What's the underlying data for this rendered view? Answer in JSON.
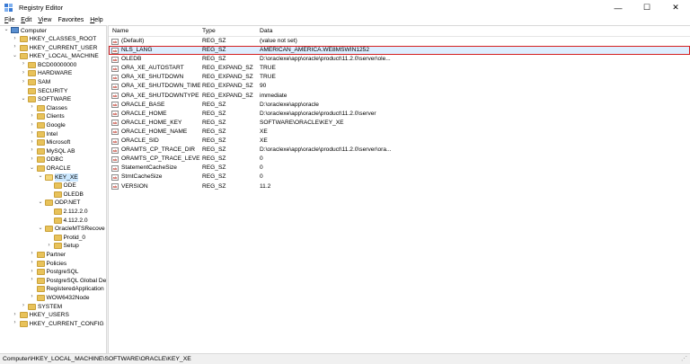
{
  "window": {
    "title": "Registry Editor",
    "minimize_glyph": "—",
    "maximize_glyph": "☐",
    "close_glyph": "✕"
  },
  "menu": [
    {
      "key": "F",
      "rest": "ile"
    },
    {
      "key": "E",
      "rest": "dit"
    },
    {
      "key": "V",
      "rest": "iew"
    },
    {
      "key": "",
      "rest": "Favorites"
    },
    {
      "key": "H",
      "rest": "elp"
    }
  ],
  "tree": [
    {
      "label": "Computer",
      "depth": 0,
      "expander": "⌄",
      "icon": "computer",
      "selected": false
    },
    {
      "label": "HKEY_CLASSES_ROOT",
      "depth": 1,
      "expander": "›",
      "icon": "folder",
      "selected": false
    },
    {
      "label": "HKEY_CURRENT_USER",
      "depth": 1,
      "expander": "›",
      "icon": "folder",
      "selected": false
    },
    {
      "label": "HKEY_LOCAL_MACHINE",
      "depth": 1,
      "expander": "⌄",
      "icon": "folder",
      "selected": false
    },
    {
      "label": "BCD00000000",
      "depth": 2,
      "expander": "›",
      "icon": "folder",
      "selected": false
    },
    {
      "label": "HARDWARE",
      "depth": 2,
      "expander": "›",
      "icon": "folder",
      "selected": false
    },
    {
      "label": "SAM",
      "depth": 2,
      "expander": "›",
      "icon": "folder",
      "selected": false
    },
    {
      "label": "SECURITY",
      "depth": 2,
      "expander": "",
      "icon": "folder",
      "selected": false
    },
    {
      "label": "SOFTWARE",
      "depth": 2,
      "expander": "⌄",
      "icon": "folder",
      "selected": false
    },
    {
      "label": "Classes",
      "depth": 3,
      "expander": "›",
      "icon": "folder",
      "selected": false
    },
    {
      "label": "Clients",
      "depth": 3,
      "expander": "›",
      "icon": "folder",
      "selected": false
    },
    {
      "label": "Google",
      "depth": 3,
      "expander": "›",
      "icon": "folder",
      "selected": false
    },
    {
      "label": "Intel",
      "depth": 3,
      "expander": "›",
      "icon": "folder",
      "selected": false
    },
    {
      "label": "Microsoft",
      "depth": 3,
      "expander": "›",
      "icon": "folder",
      "selected": false
    },
    {
      "label": "MySQL AB",
      "depth": 3,
      "expander": "›",
      "icon": "folder",
      "selected": false
    },
    {
      "label": "ODBC",
      "depth": 3,
      "expander": "›",
      "icon": "folder",
      "selected": false
    },
    {
      "label": "ORACLE",
      "depth": 3,
      "expander": "⌄",
      "icon": "folder",
      "selected": false
    },
    {
      "label": "KEY_XE",
      "depth": 4,
      "expander": "⌄",
      "icon": "folder-open",
      "selected": true
    },
    {
      "label": "ODE",
      "depth": 5,
      "expander": "",
      "icon": "folder",
      "selected": false
    },
    {
      "label": "OLEDB",
      "depth": 5,
      "expander": "",
      "icon": "folder",
      "selected": false
    },
    {
      "label": "ODP.NET",
      "depth": 4,
      "expander": "⌄",
      "icon": "folder",
      "selected": false
    },
    {
      "label": "2.112.2.0",
      "depth": 5,
      "expander": "",
      "icon": "folder",
      "selected": false
    },
    {
      "label": "4.112.2.0",
      "depth": 5,
      "expander": "",
      "icon": "folder",
      "selected": false
    },
    {
      "label": "OracleMTSRecove",
      "depth": 4,
      "expander": "⌄",
      "icon": "folder",
      "selected": false
    },
    {
      "label": "Protid_0",
      "depth": 5,
      "expander": "",
      "icon": "folder",
      "selected": false
    },
    {
      "label": "Setup",
      "depth": 5,
      "expander": "›",
      "icon": "folder",
      "selected": false
    },
    {
      "label": "Partner",
      "depth": 3,
      "expander": "›",
      "icon": "folder",
      "selected": false
    },
    {
      "label": "Policies",
      "depth": 3,
      "expander": "›",
      "icon": "folder",
      "selected": false
    },
    {
      "label": "PostgreSQL",
      "depth": 3,
      "expander": "›",
      "icon": "folder",
      "selected": false
    },
    {
      "label": "PostgreSQL Global De",
      "depth": 3,
      "expander": "›",
      "icon": "folder",
      "selected": false
    },
    {
      "label": "RegisteredApplication",
      "depth": 3,
      "expander": "",
      "icon": "folder",
      "selected": false
    },
    {
      "label": "WOW6432Node",
      "depth": 3,
      "expander": "›",
      "icon": "folder",
      "selected": false
    },
    {
      "label": "SYSTEM",
      "depth": 2,
      "expander": "›",
      "icon": "folder",
      "selected": false
    },
    {
      "label": "HKEY_USERS",
      "depth": 1,
      "expander": "›",
      "icon": "folder",
      "selected": false
    },
    {
      "label": "HKEY_CURRENT_CONFIG",
      "depth": 1,
      "expander": "›",
      "icon": "folder",
      "selected": false
    }
  ],
  "list": {
    "columns": [
      "Name",
      "Type",
      "Data"
    ],
    "rows": [
      {
        "name": "(Default)",
        "type": "REG_SZ",
        "data": "(value not set)",
        "icon": "string",
        "highlighted": false
      },
      {
        "name": "NLS_LANG",
        "type": "REG_SZ",
        "data": "AMERICAN_AMERICA.WE8MSWIN1252",
        "icon": "string",
        "highlighted": true
      },
      {
        "name": "OLEDB",
        "type": "REG_SZ",
        "data": "D:\\oraclexe\\app\\oracle\\product\\11.2.0\\server\\ole...",
        "icon": "string",
        "highlighted": false
      },
      {
        "name": "ORA_XE_AUTOSTART",
        "type": "REG_EXPAND_SZ",
        "data": "TRUE",
        "icon": "string",
        "highlighted": false
      },
      {
        "name": "ORA_XE_SHUTDOWN",
        "type": "REG_EXPAND_SZ",
        "data": "TRUE",
        "icon": "string",
        "highlighted": false
      },
      {
        "name": "ORA_XE_SHUTDOWN_TIMEOUT",
        "type": "REG_EXPAND_SZ",
        "data": "90",
        "icon": "string",
        "highlighted": false
      },
      {
        "name": "ORA_XE_SHUTDOWNTYPE",
        "type": "REG_EXPAND_SZ",
        "data": "immediate",
        "icon": "string",
        "highlighted": false
      },
      {
        "name": "ORACLE_BASE",
        "type": "REG_SZ",
        "data": "D:\\oraclexe\\app\\oracle",
        "icon": "string",
        "highlighted": false
      },
      {
        "name": "ORACLE_HOME",
        "type": "REG_SZ",
        "data": "D:\\oraclexe\\app\\oracle\\product\\11.2.0\\server",
        "icon": "string",
        "highlighted": false
      },
      {
        "name": "ORACLE_HOME_KEY",
        "type": "REG_SZ",
        "data": "SOFTWARE\\ORACLE\\KEY_XE",
        "icon": "string",
        "highlighted": false
      },
      {
        "name": "ORACLE_HOME_NAME",
        "type": "REG_SZ",
        "data": "XE",
        "icon": "string",
        "highlighted": false
      },
      {
        "name": "ORACLE_SID",
        "type": "REG_SZ",
        "data": "XE",
        "icon": "string",
        "highlighted": false
      },
      {
        "name": "ORAMTS_CP_TRACE_DIR",
        "type": "REG_SZ",
        "data": "D:\\oraclexe\\app\\oracle\\product\\11.2.0\\server\\ora...",
        "icon": "string",
        "highlighted": false
      },
      {
        "name": "ORAMTS_CP_TRACE_LEVEL",
        "type": "REG_SZ",
        "data": "0",
        "icon": "string",
        "highlighted": false
      },
      {
        "name": "StatementCacheSize",
        "type": "REG_SZ",
        "data": "0",
        "icon": "string",
        "highlighted": false
      },
      {
        "name": "StmtCacheSize",
        "type": "REG_SZ",
        "data": "0",
        "icon": "string",
        "highlighted": false
      },
      {
        "name": "VERSION",
        "type": "REG_SZ",
        "data": "11.2",
        "icon": "string",
        "highlighted": false
      }
    ]
  },
  "status": {
    "path": "Computer\\HKEY_LOCAL_MACHINE\\SOFTWARE\\ORACLE\\KEY_XE"
  },
  "colors": {
    "highlight_border": "#d42020",
    "selection": "#cce8ff",
    "folder": "#e8c25a"
  }
}
